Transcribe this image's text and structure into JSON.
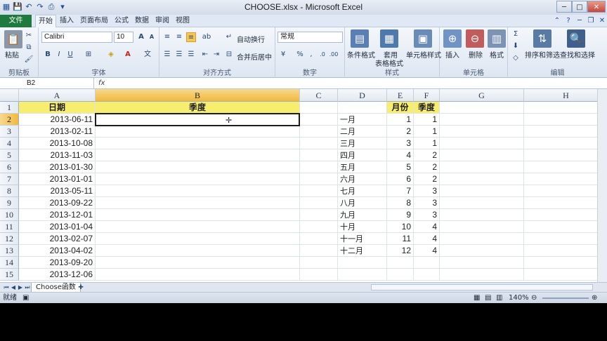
{
  "window": {
    "title": "CHOOSE.xlsx - Microsoft Excel",
    "min_label": "─",
    "max_label": "□",
    "close_label": "✕"
  },
  "tabs": {
    "file": "文件",
    "items": [
      "开始",
      "插入",
      "页面布局",
      "公式",
      "数据",
      "审阅",
      "视图"
    ]
  },
  "ribbon": {
    "clipboard": {
      "label": "剪贴板",
      "paste": "粘贴"
    },
    "font": {
      "label": "字体",
      "name": "Calibri",
      "size": "10"
    },
    "alignment": {
      "label": "对齐方式",
      "wrap": "自动换行",
      "merge": "合并后居中"
    },
    "number": {
      "label": "数字",
      "format": "常规"
    },
    "styles": {
      "label": "样式",
      "conditional": "条件格式",
      "table1": "套用",
      "table2": "表格格式",
      "cell_styles": "单元格样式"
    },
    "cells": {
      "label": "单元格",
      "insert": "插入",
      "delete": "删除",
      "format": "格式"
    },
    "editing": {
      "label": "编辑",
      "sort": "排序和筛选",
      "find": "查找和选择"
    }
  },
  "formula_bar": {
    "name_box": "B2",
    "fx": "fx",
    "formula": ""
  },
  "columns": [
    "A",
    "B",
    "C",
    "D",
    "E",
    "F",
    "G",
    "H"
  ],
  "rows": [
    "1",
    "2",
    "3",
    "4",
    "5",
    "6",
    "7",
    "8",
    "9",
    "10",
    "11",
    "12",
    "13",
    "14",
    "15"
  ],
  "headers": {
    "a1": "日期",
    "b1": "季度",
    "e1": "月份",
    "f1": "季度"
  },
  "dates": [
    "2013-06-11",
    "2013-02-11",
    "2013-10-08",
    "2013-11-03",
    "2013-01-30",
    "2013-01-01",
    "2013-05-11",
    "2013-09-22",
    "2013-12-01",
    "2013-01-04",
    "2013-02-07",
    "2013-04-02",
    "2013-09-20",
    "2013-12-06"
  ],
  "months": [
    "一月",
    "二月",
    "三月",
    "四月",
    "五月",
    "六月",
    "七月",
    "八月",
    "九月",
    "十月",
    "十一月",
    "十二月"
  ],
  "month_nums": [
    "1",
    "2",
    "3",
    "4",
    "5",
    "6",
    "7",
    "8",
    "9",
    "10",
    "11",
    "12"
  ],
  "quarters": [
    "1",
    "1",
    "1",
    "2",
    "2",
    "2",
    "3",
    "3",
    "3",
    "4",
    "4",
    "4"
  ],
  "sheet": {
    "name": "Choose函数"
  },
  "status": {
    "ready": "就绪",
    "zoom": "140%"
  }
}
